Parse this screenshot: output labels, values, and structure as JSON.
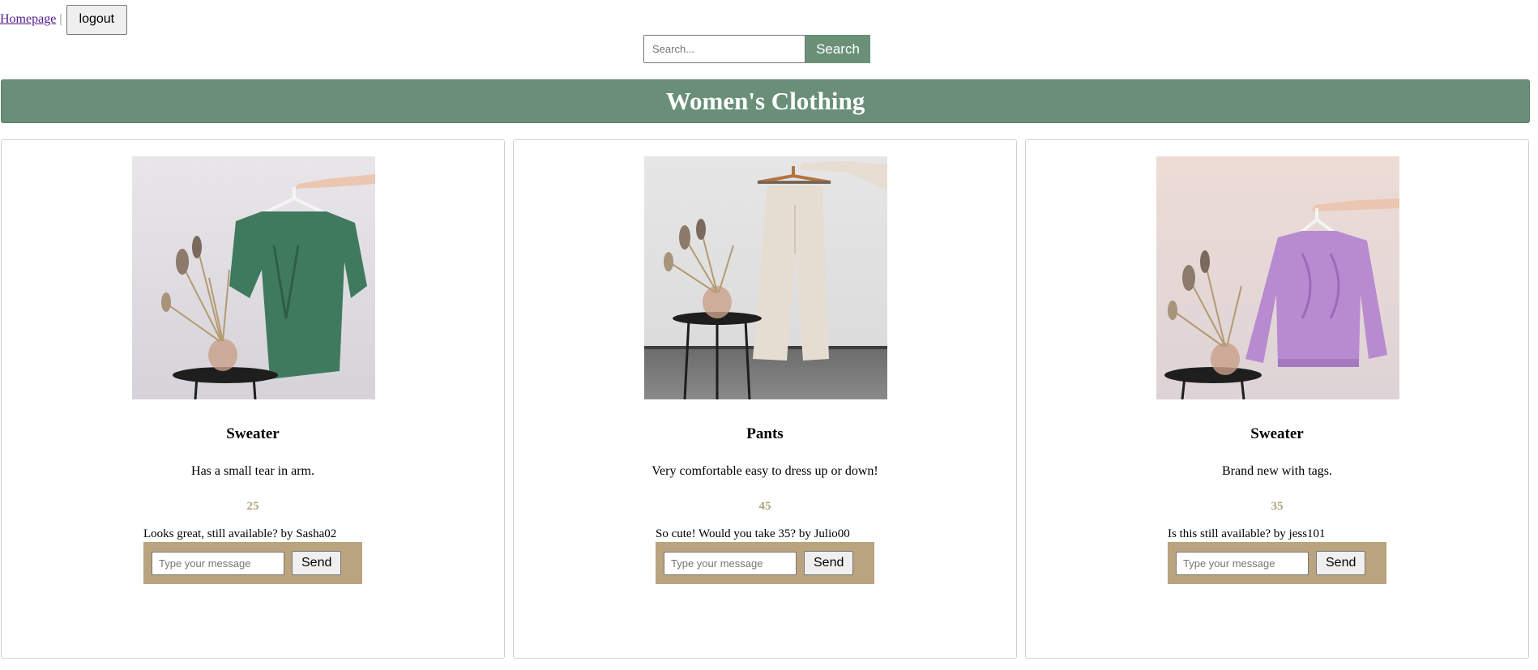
{
  "nav": {
    "home_link": "Homepage",
    "separator": "|",
    "logout_label": "logout"
  },
  "search": {
    "placeholder": "Search...",
    "button_label": "Search"
  },
  "banner": {
    "title": "Women's Clothing"
  },
  "products": [
    {
      "name": "Sweater",
      "description": "Has a small tear in arm.",
      "price": "25",
      "comment": "Looks great, still available? by Sasha02",
      "message_placeholder": "Type your message",
      "send_label": "Send",
      "photo_icon": "green-sweater-photo",
      "garment_color": "#3f7a5e"
    },
    {
      "name": "Pants",
      "description": "Very comfortable easy to dress up or down!",
      "price": "45",
      "comment": "So cute! Would you take 35? by Julio00",
      "message_placeholder": "Type your message",
      "send_label": "Send",
      "photo_icon": "cream-pants-photo",
      "garment_color": "#e6ddd2"
    },
    {
      "name": "Sweater",
      "description": "Brand new with tags.",
      "price": "35",
      "comment": "Is this still available? by jess101",
      "message_placeholder": "Type your message",
      "send_label": "Send",
      "photo_icon": "lilac-sweater-photo",
      "garment_color": "#b88ad0"
    }
  ],
  "colors": {
    "accent_green": "#6a8f79",
    "price_tan": "#b5a47c",
    "message_box_tan": "#b9a47f"
  }
}
